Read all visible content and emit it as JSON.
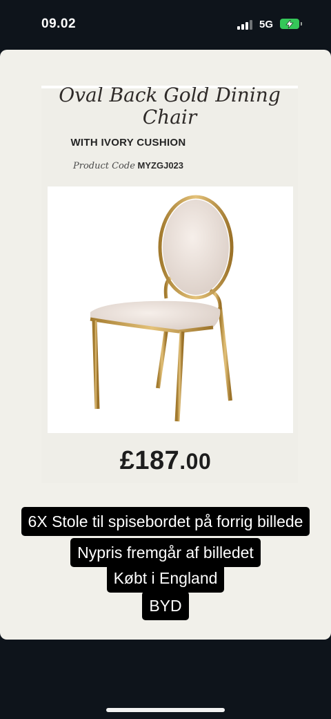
{
  "status_bar": {
    "time": "09.02",
    "network": "5G",
    "icons": [
      "signal-bars-icon",
      "battery-charging-icon"
    ],
    "battery_color": "#35c759"
  },
  "product": {
    "title_line1": "Oval Back Gold Dining",
    "title_line2": "Chair",
    "subtitle": "WITH IVORY CUSHION",
    "code_label": "Product Code",
    "code_value": "MYZGJ023",
    "price_main": "£187",
    "price_decimal": ".00"
  },
  "caption": {
    "line1": "6X Stole til spisebordet på forrig billede",
    "line2": "Nypris fremgår af billedet",
    "line3": "Købt i England",
    "line4": "BYD"
  },
  "colors": {
    "background": "#0e141b",
    "card": "#f1f0ea",
    "gold": "#c9a04c",
    "cushion": "#ece3dc"
  }
}
